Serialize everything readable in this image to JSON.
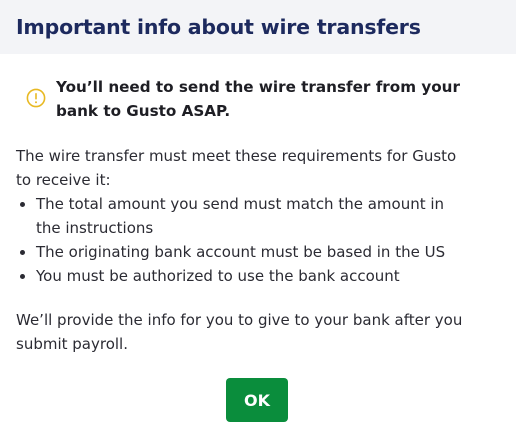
{
  "dialog": {
    "title": "Important info about wire transfers",
    "alert": {
      "icon": "warning-circle-icon",
      "icon_color": "#e8b923",
      "text": "You’ll need to send the wire transfer from your bank to Gusto ASAP."
    },
    "intro": "The wire transfer must meet these requirements for Gusto to receive it:",
    "requirements": [
      "The total amount you send must match the amount in the instructions",
      "The originating bank account must be based in the US",
      "You must be authorized to use the bank account"
    ],
    "outro": "We’ll provide the info for you to give to your bank after you submit payroll.",
    "ok_label": "OK"
  },
  "colors": {
    "header_bg": "#f3f4f7",
    "title": "#1d2a5e",
    "primary_button": "#0a8d3c"
  }
}
